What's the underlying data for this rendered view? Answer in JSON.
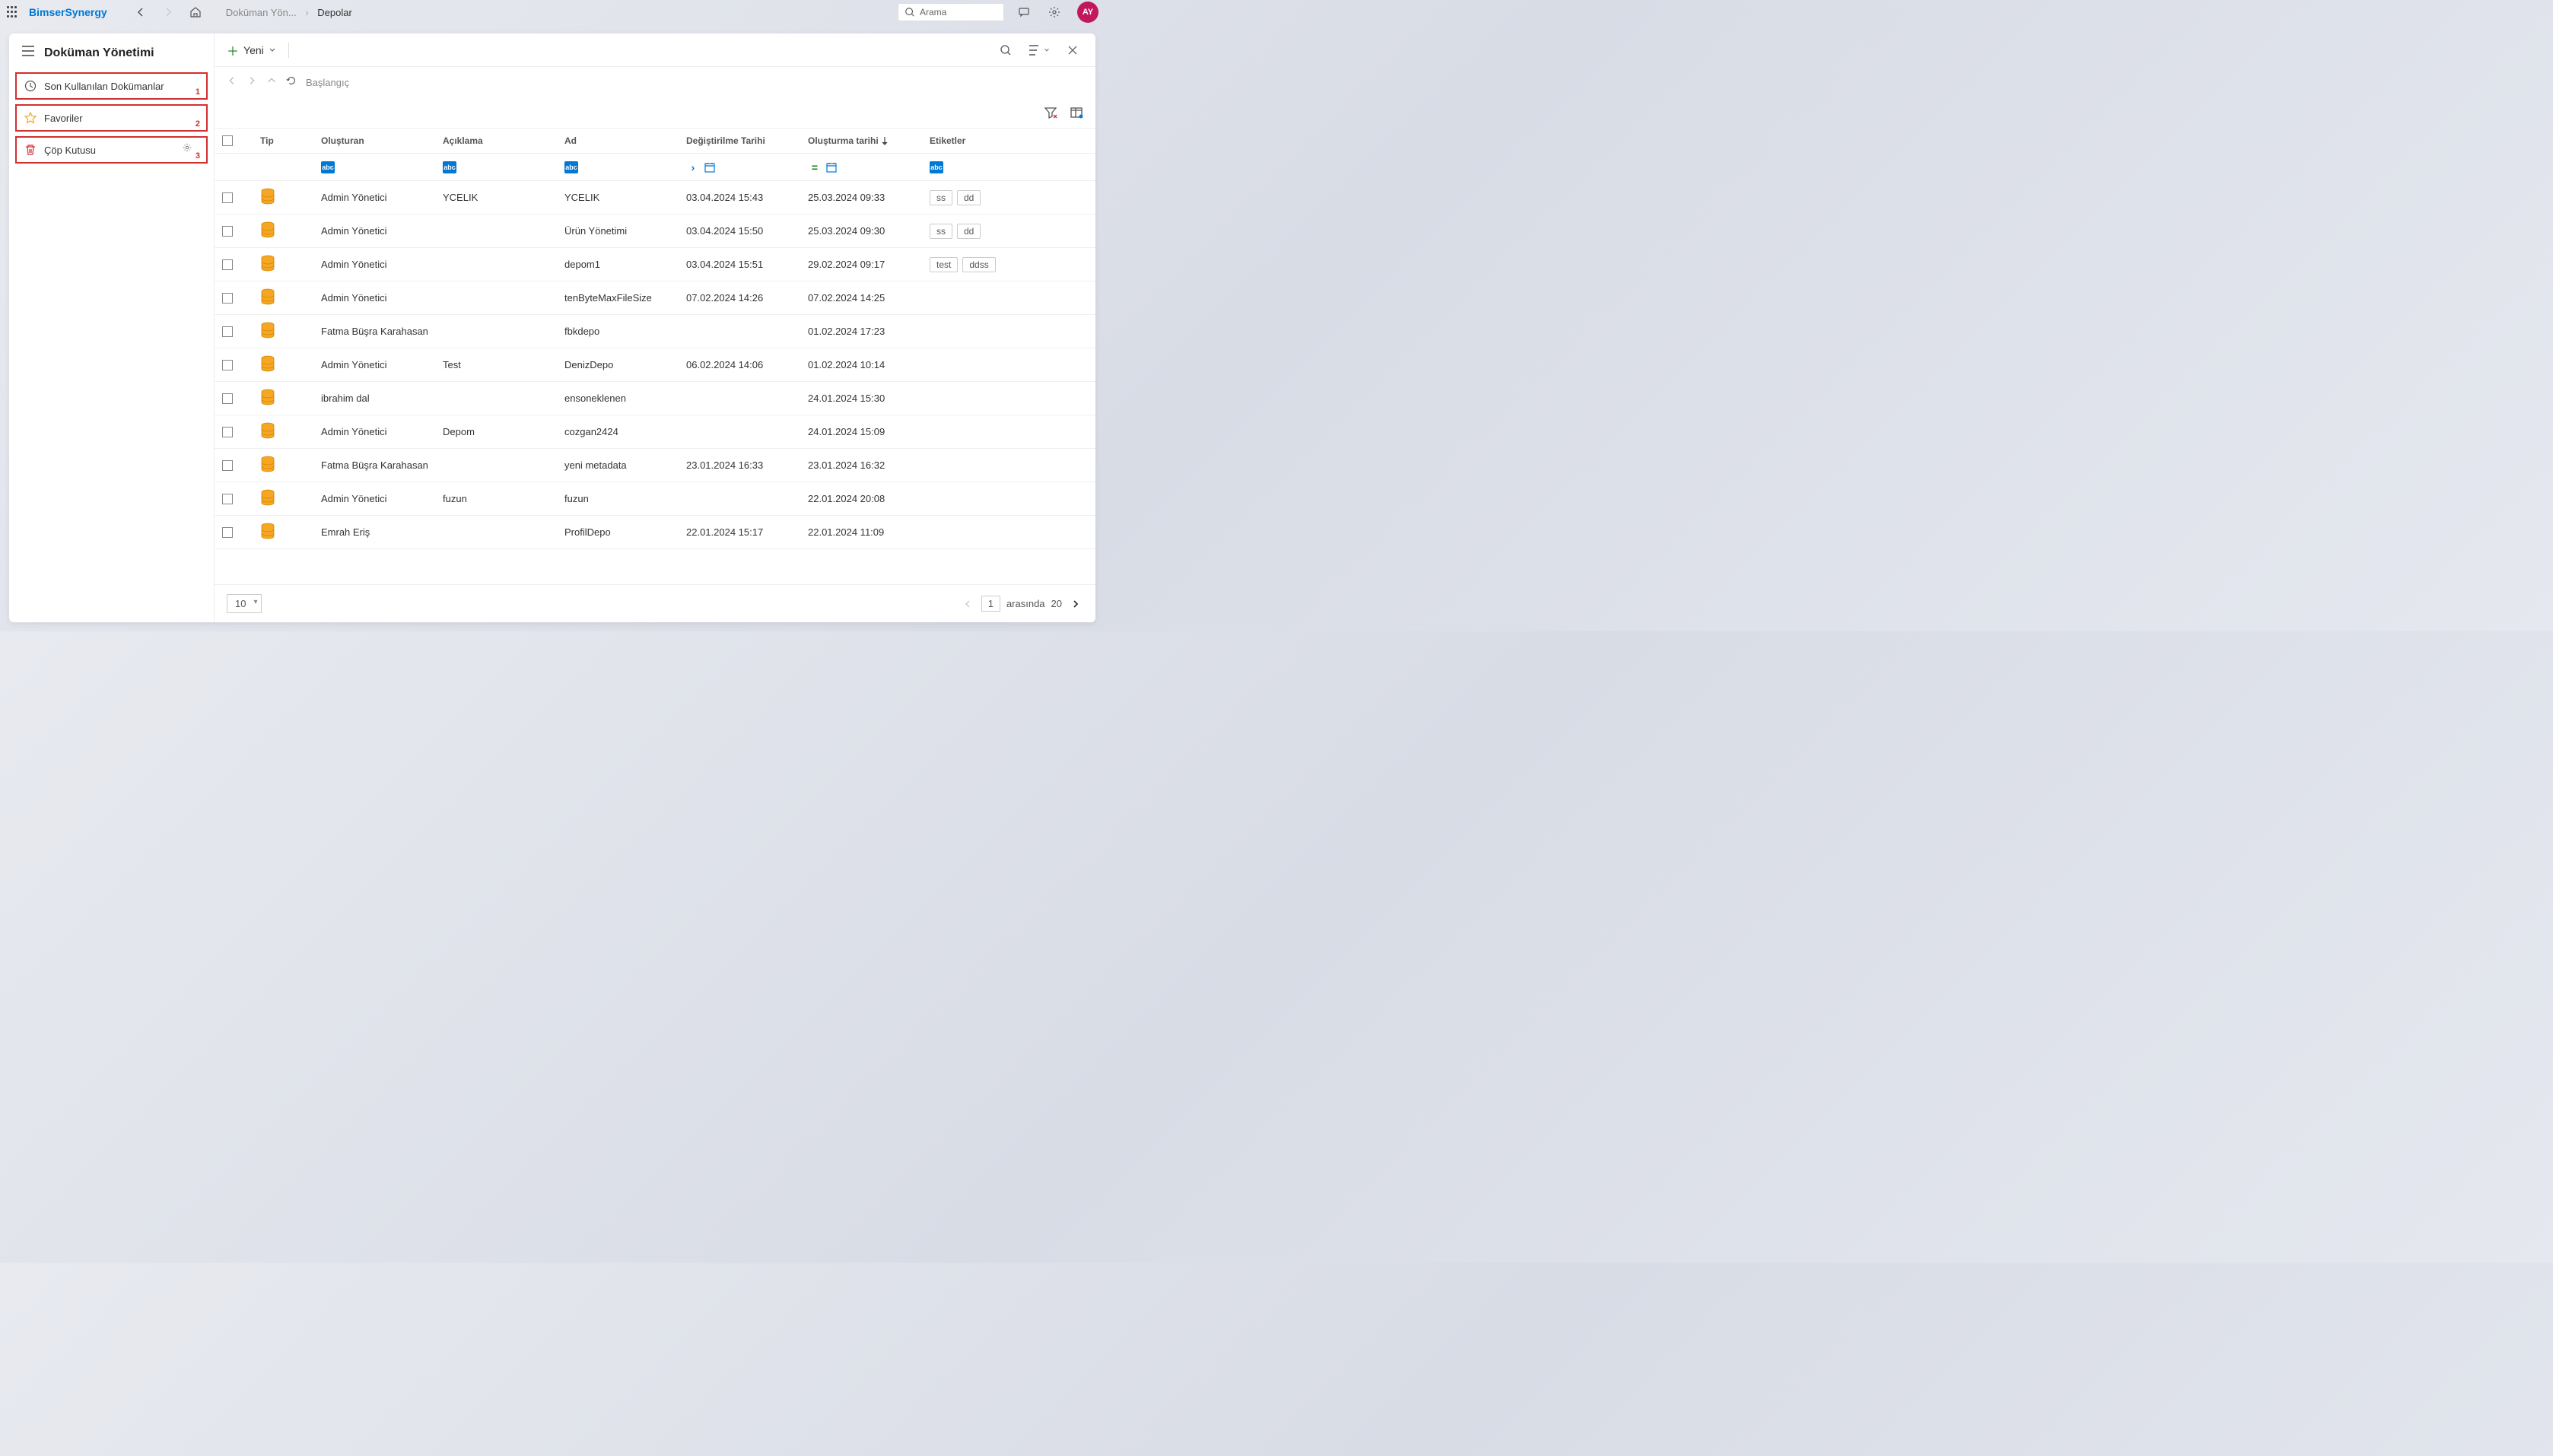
{
  "brand": "BimserSynergy",
  "breadcrumb": {
    "parent": "Doküman Yön...",
    "current": "Depolar"
  },
  "search": {
    "placeholder": "Arama"
  },
  "avatar": "AY",
  "sidebar": {
    "title": "Doküman Yönetimi",
    "items": [
      {
        "label": "Son Kullanılan Dokümanlar",
        "num": "1"
      },
      {
        "label": "Favoriler",
        "num": "2"
      },
      {
        "label": "Çöp Kutusu",
        "num": "3"
      }
    ]
  },
  "toolbar": {
    "new_label": "Yeni"
  },
  "nav": {
    "start": "Başlangıç"
  },
  "columns": {
    "tip": "Tip",
    "olusturan": "Oluşturan",
    "aciklama": "Açıklama",
    "ad": "Ad",
    "degis": "Değiştirilme Tarihi",
    "olus": "Oluşturma tarihi",
    "etiket": "Etiketler"
  },
  "rows": [
    {
      "olusturan": "Admin Yönetici",
      "aciklama": "YCELIK",
      "ad": "YCELIK",
      "degis": "03.04.2024 15:43",
      "olus": "25.03.2024 09:33",
      "tags": [
        "ss",
        "dd"
      ]
    },
    {
      "olusturan": "Admin Yönetici",
      "aciklama": "",
      "ad": "Ürün Yönetimi",
      "degis": "03.04.2024 15:50",
      "olus": "25.03.2024 09:30",
      "tags": [
        "ss",
        "dd"
      ]
    },
    {
      "olusturan": "Admin Yönetici",
      "aciklama": "",
      "ad": "depom1",
      "degis": "03.04.2024 15:51",
      "olus": "29.02.2024 09:17",
      "tags": [
        "test",
        "ddss"
      ]
    },
    {
      "olusturan": "Admin Yönetici",
      "aciklama": "",
      "ad": "tenByteMaxFileSize",
      "degis": "07.02.2024 14:26",
      "olus": "07.02.2024 14:25",
      "tags": []
    },
    {
      "olusturan": "Fatma Büşra Karahasan",
      "aciklama": "",
      "ad": "fbkdepo",
      "degis": "",
      "olus": "01.02.2024 17:23",
      "tags": []
    },
    {
      "olusturan": "Admin Yönetici",
      "aciklama": "Test",
      "ad": "DenizDepo",
      "degis": "06.02.2024 14:06",
      "olus": "01.02.2024 10:14",
      "tags": []
    },
    {
      "olusturan": "ibrahim dal",
      "aciklama": "",
      "ad": "ensoneklenen",
      "degis": "",
      "olus": "24.01.2024 15:30",
      "tags": []
    },
    {
      "olusturan": "Admin Yönetici",
      "aciklama": "Depom",
      "ad": "cozgan2424",
      "degis": "",
      "olus": "24.01.2024 15:09",
      "tags": []
    },
    {
      "olusturan": "Fatma Büşra Karahasan",
      "aciklama": "",
      "ad": "yeni metadata",
      "degis": "23.01.2024 16:33",
      "olus": "23.01.2024 16:32",
      "tags": []
    },
    {
      "olusturan": "Admin Yönetici",
      "aciklama": "fuzun",
      "ad": "fuzun",
      "degis": "",
      "olus": "22.01.2024 20:08",
      "tags": []
    },
    {
      "olusturan": "Emrah Eriş",
      "aciklama": "",
      "ad": "ProfilDepo",
      "degis": "22.01.2024 15:17",
      "olus": "22.01.2024 11:09",
      "tags": []
    }
  ],
  "footer": {
    "pagesize": "10",
    "page": "1",
    "between": "arasında",
    "total": "20"
  }
}
